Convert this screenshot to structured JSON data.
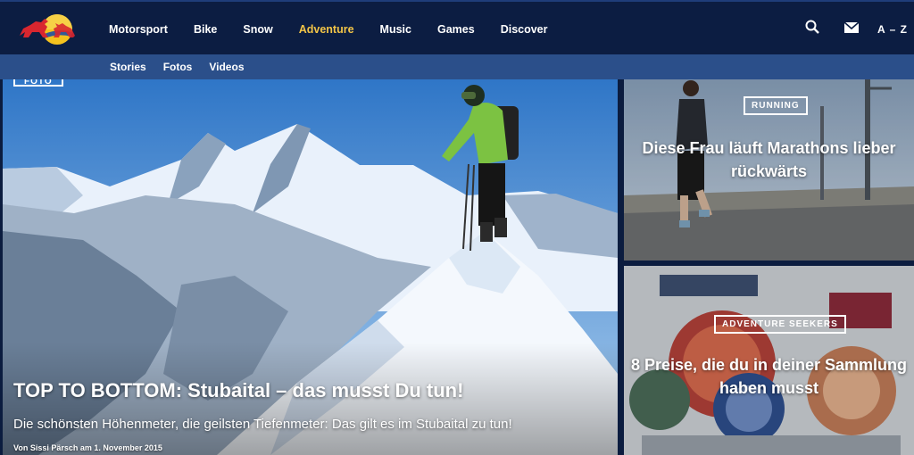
{
  "brand": {
    "logo_icon": "red-bull-logo-icon"
  },
  "nav": {
    "items": [
      {
        "label": "Motorsport",
        "active": false
      },
      {
        "label": "Bike",
        "active": false
      },
      {
        "label": "Snow",
        "active": false
      },
      {
        "label": "Adventure",
        "active": true
      },
      {
        "label": "Music",
        "active": false
      },
      {
        "label": "Games",
        "active": false
      },
      {
        "label": "Discover",
        "active": false
      }
    ],
    "search_icon": "search-icon",
    "mail_icon": "envelope-icon",
    "az_label": "A – Z",
    "active_color": "#f3c547"
  },
  "subnav": {
    "items": [
      {
        "label": "Stories"
      },
      {
        "label": "Fotos"
      },
      {
        "label": "Videos"
      }
    ]
  },
  "hero": {
    "tag": "FOTO",
    "title": "TOP TO BOTTOM: Stubaital – das musst Du tun!",
    "subtitle": "Die schönsten Höhenmeter, die geilsten Tiefenmeter: Das gilt es im Stubaital zu tun!",
    "byline": "Von Sissi Pärsch am 1. November 2015"
  },
  "tiles": [
    {
      "badge": "RUNNING",
      "title": "Diese Frau läuft Marathons lieber rückwärts"
    },
    {
      "badge": "ADVENTURE SEEKERS",
      "title": "8 Preise, die du in deiner Sammlung haben musst"
    }
  ],
  "colors": {
    "nav_bg": "#0c1d42",
    "subnav_bg": "#2b4f8a",
    "accent": "#f3c547"
  }
}
